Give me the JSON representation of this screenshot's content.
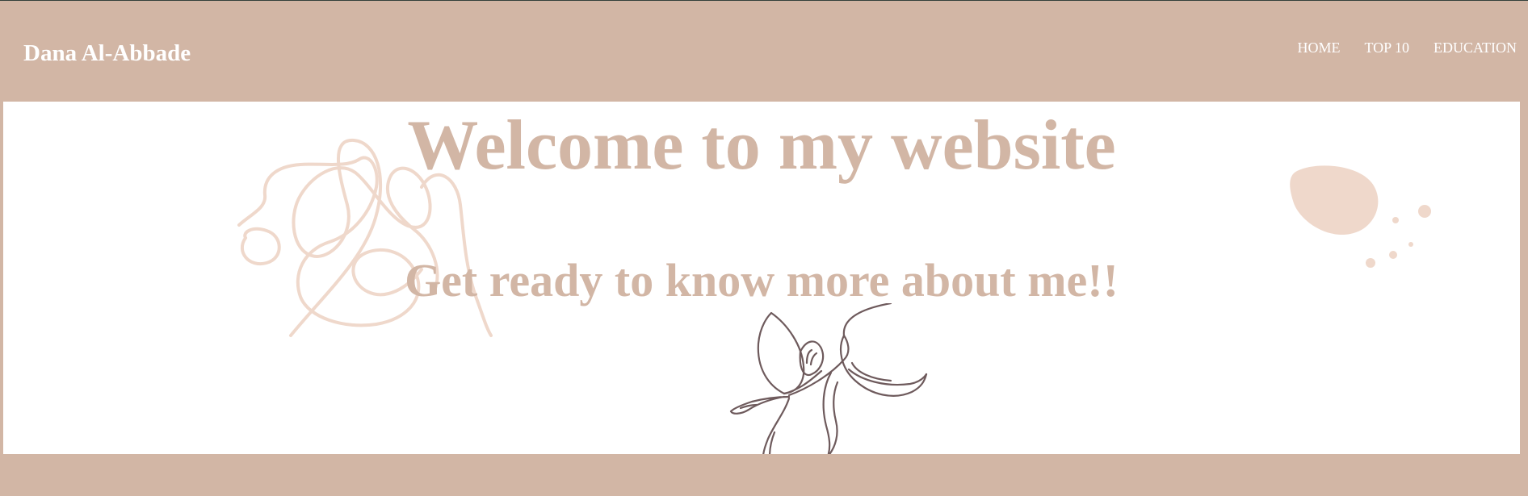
{
  "header": {
    "brand": "Dana Al-Abbade",
    "nav": [
      {
        "label": "HOME"
      },
      {
        "label": "TOP 10"
      },
      {
        "label": "EDUCATION"
      }
    ]
  },
  "hero": {
    "title": "Welcome to my website",
    "subtitle": "Get ready to know more about me!!"
  },
  "colors": {
    "accent": "#d2b6a5",
    "background": "#ffffff",
    "decoration_light": "#efd8cb",
    "line_art": "#6e5a5c"
  },
  "decorations": [
    "abstract-squiggle-graphic",
    "blob-and-dots-graphic",
    "flower-line-art"
  ]
}
